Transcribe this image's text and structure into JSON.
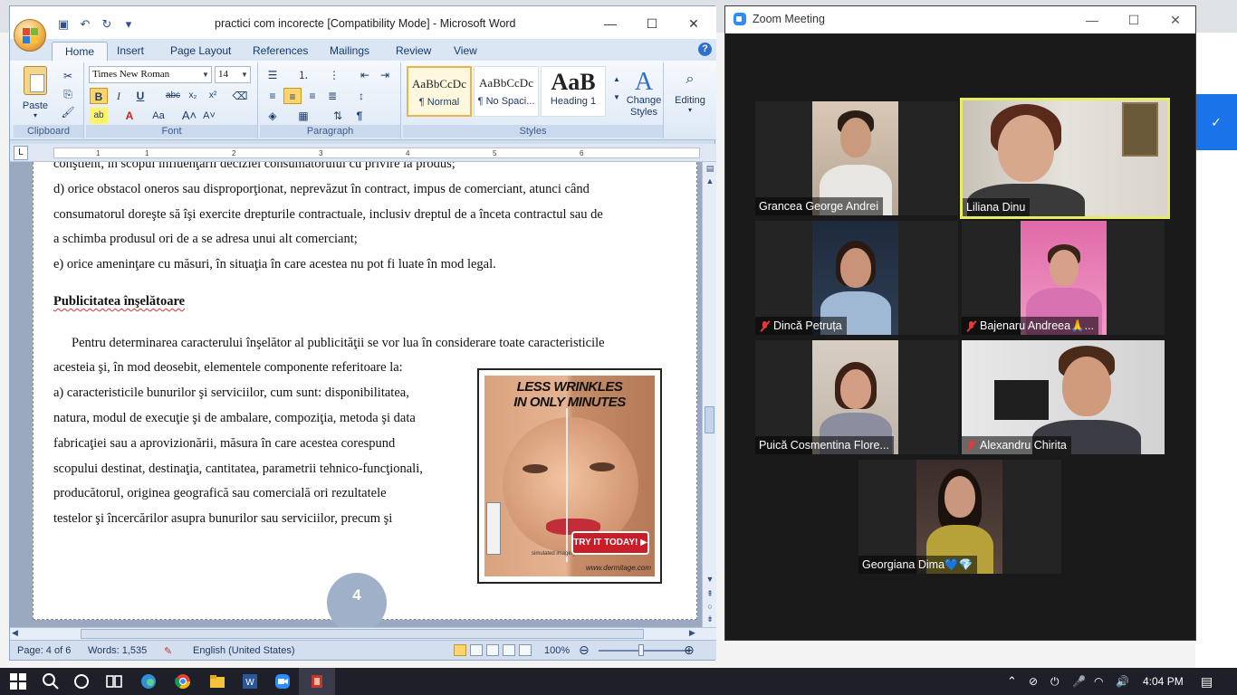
{
  "word": {
    "title": "practici com incorecte [Compatibility Mode] - Microsoft Word",
    "tabs": [
      "Home",
      "Insert",
      "Page Layout",
      "References",
      "Mailings",
      "Review",
      "View"
    ],
    "active_tab": "Home",
    "font_name": "Times New Roman",
    "font_size": "14",
    "groups": {
      "clipboard": "Clipboard",
      "font": "Font",
      "paragraph": "Paragraph",
      "styles": "Styles"
    },
    "paste_label": "Paste",
    "styles": [
      {
        "preview": "AaBbCcDc",
        "name": "¶ Normal"
      },
      {
        "preview": "AaBbCcDc",
        "name": "¶ No Spaci..."
      },
      {
        "preview": "AaB",
        "name": "Heading 1"
      }
    ],
    "change_styles_label": "Change Styles",
    "editing_label": "Editing",
    "ruler_ticks": [
      "1",
      "1",
      "2",
      "3",
      "4",
      "5",
      "6"
    ],
    "document": {
      "lines": [
        "conştient, în scopul influenţării deciziei consumatorului  cu privire la produs;",
        "d) orice obstacol oneros sau disproporţionat, neprevăzut în contract, impus de comerciant, atunci când",
        "consumatorul doreşte să îşi exercite drepturile contractuale, inclusiv dreptul de a înceta contractul sau de",
        "a schimba produsul ori de a se adresa unui alt comerciant;",
        "e) orice ameninţare cu măsuri, în situaţia în care acestea nu pot fi luate în mod legal."
      ],
      "heading": "Publicitatea înşelătoare",
      "para_lines": [
        "Pentru determinarea caracterului înşelător al publicităţii se vor lua în considerare toate caracteristicile",
        "acesteia şi, în mod deosebit, elementele componente referitoare la:",
        "a) caracteristicile  bunurilor şi serviciilor,  cum sunt: disponibilitatea,",
        "natura, modul de execuţie şi de ambalare,  compoziţia, metoda şi data",
        "fabricaţiei sau a aprovizionării,  măsura în care acestea corespund",
        "scopului destinat, destinaţia, cantitatea, parametrii tehnico-funcţionali,",
        "producătorul, originea geografică sau comercială  ori rezultatele",
        "testelor şi încercărilor  asupra bunurilor  sau serviciilor,  precum şi"
      ],
      "ad": {
        "headline_1": "LESS WRINKLES",
        "headline_2": "IN ONLY MINUTES",
        "button": "TRY IT TODAY! ▶",
        "caption": "simulated imagery",
        "url": "www.dermitage.com"
      },
      "page_number": "4"
    },
    "status": {
      "page": "Page: 4 of 6",
      "words": "Words: 1,535",
      "language": "English (United States)",
      "zoom": "100%"
    }
  },
  "zoom_app": {
    "title": "Zoom Meeting",
    "participants": [
      {
        "name": "Grancea George Andrei",
        "muted": false,
        "active": false
      },
      {
        "name": "Liliana Dinu",
        "muted": false,
        "active": true
      },
      {
        "name": "Dincă Petruța",
        "muted": true,
        "active": false
      },
      {
        "name": "Bajenaru Andreea🙏...",
        "muted": true,
        "active": false
      },
      {
        "name": "Puică Cosmentina Flore...",
        "muted": false,
        "active": false
      },
      {
        "name": "Alexandru Chirita",
        "muted": true,
        "active": false
      },
      {
        "name": "Georgiana Dima💙💎",
        "muted": false,
        "active": false
      }
    ]
  },
  "taskbar": {
    "time": "4:04 PM",
    "apps": [
      "start",
      "search",
      "cortana",
      "task-view",
      "edge",
      "chrome",
      "file-explorer",
      "word",
      "zoom",
      "presentation"
    ]
  },
  "colors": {
    "zoom_active_border": "#e6ec63",
    "mute_red": "#e03a3a",
    "word_ribbon": "#dde8f5",
    "taskbar": "#1f1f2a"
  }
}
